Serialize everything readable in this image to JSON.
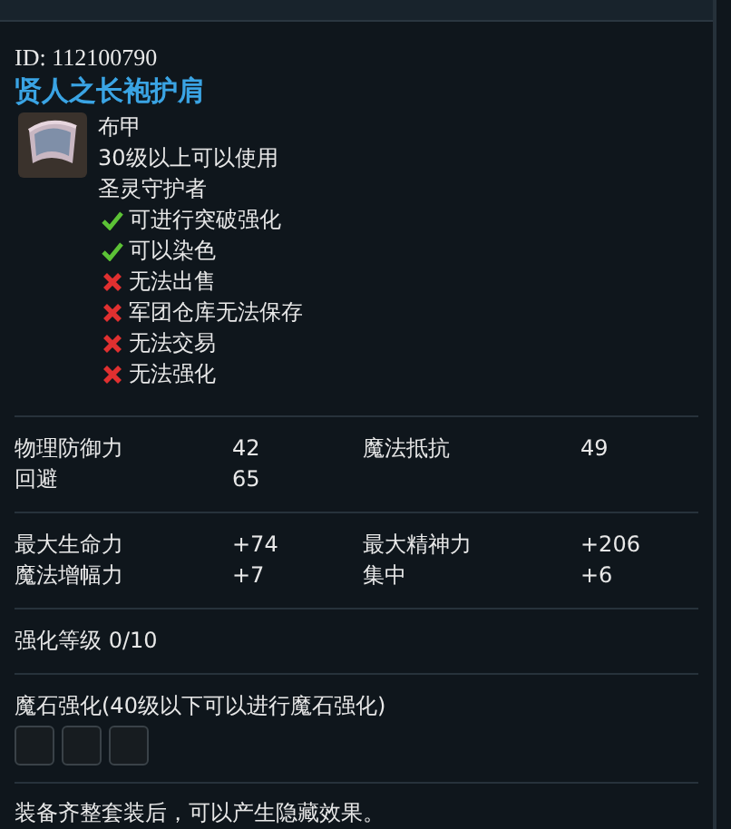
{
  "item": {
    "id": "ID: 112100790",
    "name": "贤人之长袍护肩",
    "info": [
      "布甲",
      "30级以上可以使用",
      "圣灵守护者"
    ],
    "properties": [
      {
        "kind": "allowed",
        "text": "可进行突破强化"
      },
      {
        "kind": "allowed",
        "text": "可以染色"
      },
      {
        "kind": "denied",
        "text": "无法出售"
      },
      {
        "kind": "denied",
        "text": "军团仓库无法保存"
      },
      {
        "kind": "denied",
        "text": "无法交易"
      },
      {
        "kind": "denied",
        "text": "无法强化"
      }
    ]
  },
  "stat_groups": [
    [
      {
        "label": "物理防御力",
        "value": "42"
      },
      {
        "label": "魔法抵抗",
        "value": "49"
      },
      {
        "label": "回避",
        "value": "65"
      }
    ],
    [
      {
        "label": "最大生命力",
        "value": "+74"
      },
      {
        "label": "最大精神力",
        "value": "+206"
      },
      {
        "label": "魔法增幅力",
        "value": "+7"
      },
      {
        "label": "集中",
        "value": "+6"
      }
    ]
  ],
  "enchant_level": "强化等级 0/10",
  "manastone": {
    "title": "魔石强化(40级以下可以进行魔石强化)",
    "slots": [
      {
        "filled": false
      },
      {
        "filled": false
      },
      {
        "filled": false
      }
    ]
  },
  "set_note": "装备齐整套装后，可以产生隐藏效果。"
}
